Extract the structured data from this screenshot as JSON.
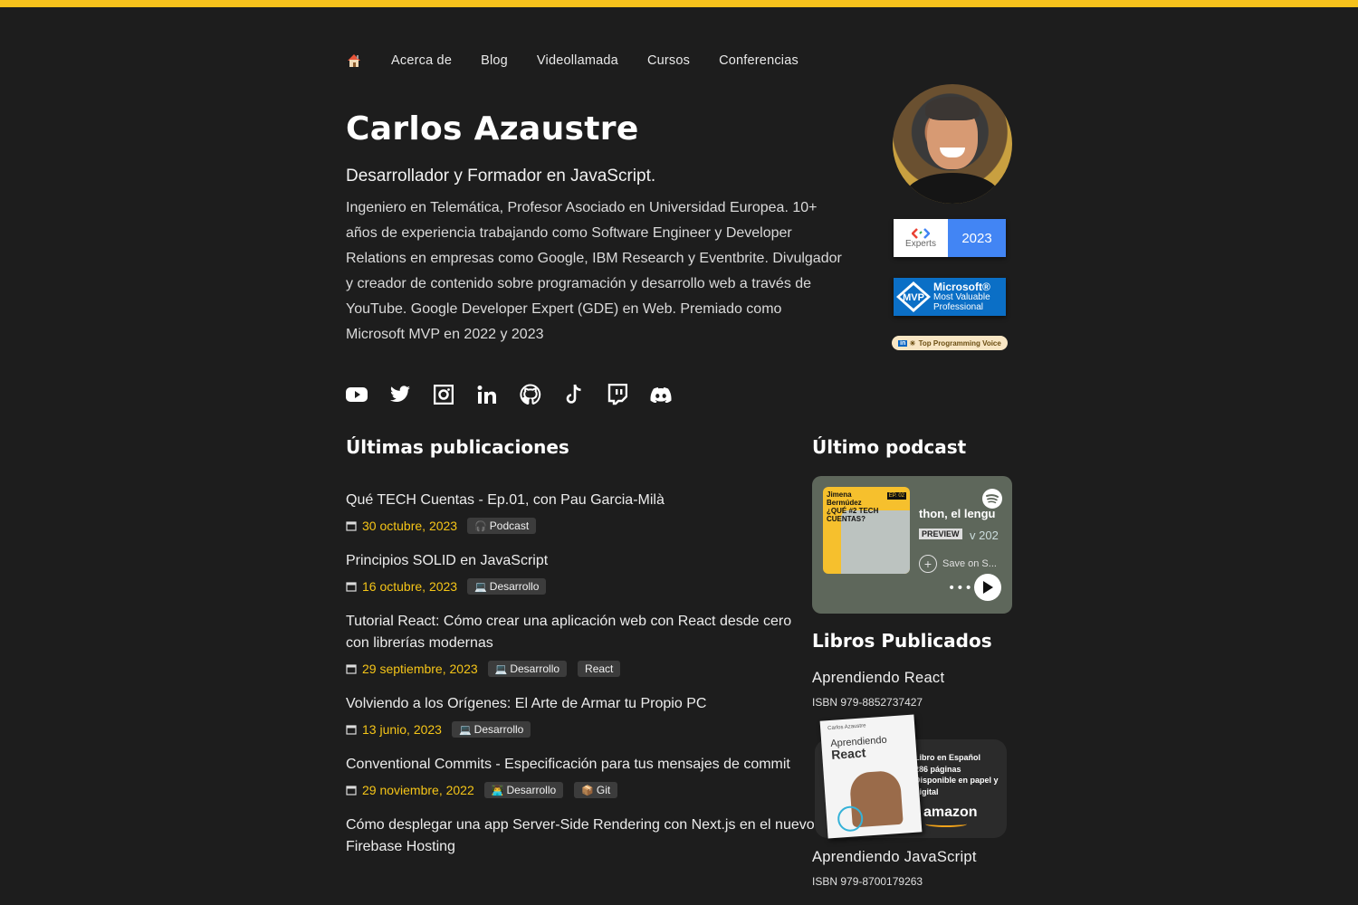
{
  "colors": {
    "accent": "#f7c21c",
    "background": "#1d1d1d",
    "date": "#f5c518",
    "tag_bg": "#3c3c3c"
  },
  "nav": {
    "home_icon": "house-icon",
    "items": [
      "Acerca de",
      "Blog",
      "Videollamada",
      "Cursos",
      "Conferencias"
    ]
  },
  "hero": {
    "name": "Carlos Azaustre",
    "tagline": "Desarrollador y Formador en JavaScript.",
    "bio": "Ingeniero en Telemática, Profesor Asociado en Universidad Europea. 10+ años de experiencia trabajando como Software Engineer y Developer Relations en empresas como Google, IBM Research y Eventbrite. Divulgador y creador de contenido sobre programación y desarrollo web a través de YouTube. Google Developer Expert (GDE) en Web. Premiado como Microsoft MVP en 2022 y 2023"
  },
  "badges": {
    "gde_left": "Experts",
    "gde_year": "2023",
    "mvp_logo": "MVP",
    "mvp_line1": "Microsoft®",
    "mvp_line2": "Most Valuable",
    "mvp_line3": "Professional",
    "top_voice": "Top Programming Voice"
  },
  "social": [
    "youtube-icon",
    "twitter-icon",
    "instagram-icon",
    "linkedin-icon",
    "github-icon",
    "tiktok-icon",
    "twitch-icon",
    "discord-icon"
  ],
  "posts_section": {
    "heading": "Últimas publicaciones",
    "posts": [
      {
        "title": "Qué TECH Cuentas - Ep.01, con Pau Garcia-Milà",
        "date": "30 octubre, 2023",
        "tags": [
          {
            "icon": "🎧",
            "label": "Podcast"
          }
        ]
      },
      {
        "title": "Principios SOLID en JavaScript",
        "date": "16 octubre, 2023",
        "tags": [
          {
            "icon": "💻",
            "label": "Desarrollo"
          }
        ]
      },
      {
        "title": "Tutorial React: Cómo crear una aplicación web con React desde cero con librerías modernas",
        "date": "29 septiembre, 2023",
        "tags": [
          {
            "icon": "💻",
            "label": "Desarrollo"
          },
          {
            "icon": "",
            "label": "React"
          }
        ]
      },
      {
        "title": "Volviendo a los Orígenes: El Arte de Armar tu Propio PC",
        "date": "13 junio, 2023",
        "tags": [
          {
            "icon": "💻",
            "label": "Desarrollo"
          }
        ]
      },
      {
        "title": "Conventional Commits - Especificación para tus mensajes de commit",
        "date": "29 noviembre, 2022",
        "tags": [
          {
            "icon": "👨‍💻",
            "label": "Desarrollo"
          },
          {
            "icon": "📦",
            "label": "Git"
          }
        ]
      },
      {
        "title": "Cómo desplegar una app Server-Side Rendering con Next.js en el nuevo Firebase Hosting",
        "date": "",
        "tags": []
      }
    ]
  },
  "podcast": {
    "heading": "Último podcast",
    "cover_label": "Jimena Bermúdez ¿QUÉ #2 TECH CUENTAS?",
    "cover_ep": "EP. 02",
    "episode_text": "thon, el lengu",
    "preview": "PREVIEW",
    "year_fragment": "v 202",
    "save": "Save on S...",
    "dots": "•••"
  },
  "books": {
    "heading": "Libros Publicados",
    "items": [
      {
        "title": "Aprendiendo React",
        "isbn": "ISBN 979-8852737427"
      },
      {
        "title": "Aprendiendo JavaScript",
        "isbn": "ISBN 979-8700179263"
      }
    ],
    "promo": {
      "cover_author": "Carlos Azaustre",
      "cover_title_1": "Aprendiendo",
      "cover_title_2": "React",
      "info_1": "Libro en Español",
      "info_2": "286 páginas",
      "info_3": "Disponible en papel y",
      "info_4": "digital",
      "store": "amazon"
    }
  }
}
